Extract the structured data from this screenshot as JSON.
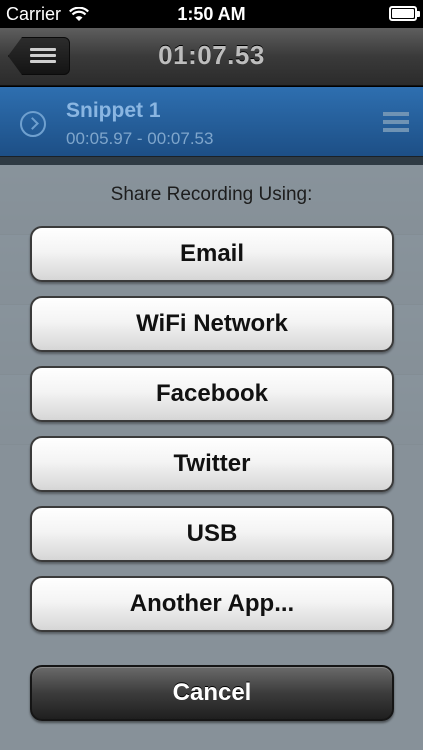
{
  "status_bar": {
    "carrier": "Carrier",
    "time": "1:50 AM"
  },
  "nav": {
    "title": "01:07.53"
  },
  "snippets": [
    {
      "name": "Snippet 1",
      "time": "00:05.97 - 00:07.53"
    }
  ],
  "share_sheet": {
    "title": "Share Recording Using:",
    "buttons": [
      "Email",
      "WiFi Network",
      "Facebook",
      "Twitter",
      "USB",
      "Another App..."
    ],
    "cancel_label": "Cancel"
  }
}
